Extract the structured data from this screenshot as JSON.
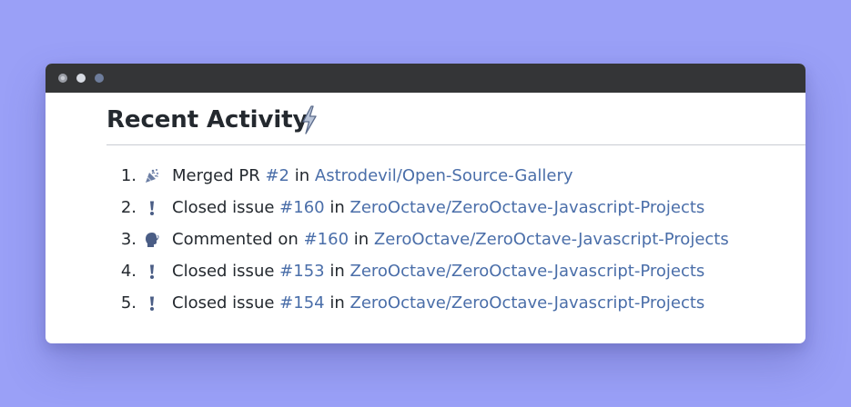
{
  "heading": {
    "title": "Recent Activity",
    "icon": "lightning-bolt-icon"
  },
  "activities": [
    {
      "number": "1.",
      "icon": "party-popper-icon",
      "action": "Merged PR",
      "ref": "#2",
      "preposition": "in",
      "repo": "Astrodevil/Open-Source-Gallery"
    },
    {
      "number": "2.",
      "icon": "exclamation-icon",
      "action": "Closed issue",
      "ref": "#160",
      "preposition": "in",
      "repo": "ZeroOctave/ZeroOctave-Javascript-Projects"
    },
    {
      "number": "3.",
      "icon": "speaking-head-icon",
      "action": "Commented on",
      "ref": "#160",
      "preposition": "in",
      "repo": "ZeroOctave/ZeroOctave-Javascript-Projects"
    },
    {
      "number": "4.",
      "icon": "exclamation-icon",
      "action": "Closed issue",
      "ref": "#153",
      "preposition": "in",
      "repo": "ZeroOctave/ZeroOctave-Javascript-Projects"
    },
    {
      "number": "5.",
      "icon": "exclamation-icon",
      "action": "Closed issue",
      "ref": "#154",
      "preposition": "in",
      "repo": "ZeroOctave/ZeroOctave-Javascript-Projects"
    }
  ],
  "colors": {
    "background": "#9aa0f7",
    "titlebar": "#343537",
    "link": "#4a6ea9",
    "text": "#24292f"
  }
}
